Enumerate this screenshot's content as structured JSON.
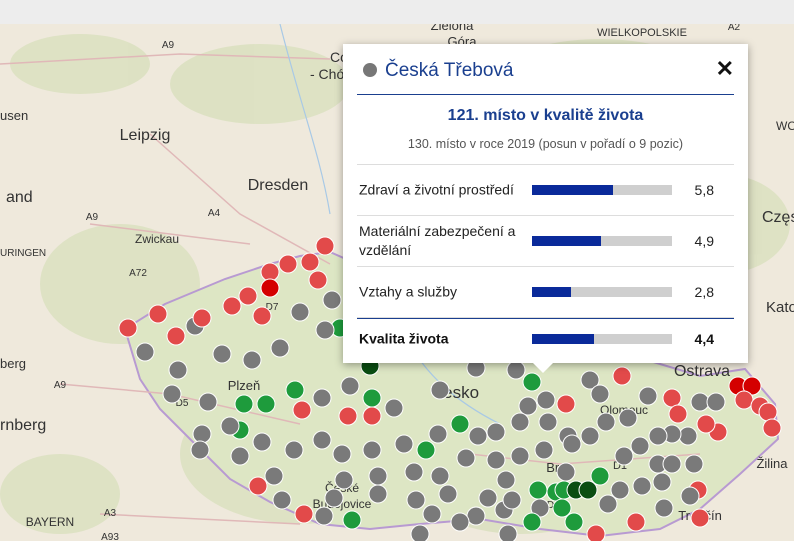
{
  "map": {
    "labels": [
      {
        "text": "Zielona",
        "id": "zielona"
      },
      {
        "text": "Góra",
        "id": "gora"
      },
      {
        "text": "WIELKOPOLSKIE",
        "id": "wielkopolskie"
      },
      {
        "text": "A2",
        "id": "a2-top"
      },
      {
        "text": "Cottb",
        "id": "cottbus"
      },
      {
        "text": "- Chóś",
        "id": "chos"
      },
      {
        "text": "A9",
        "id": "a9-top"
      },
      {
        "text": "usen",
        "id": "usen"
      },
      {
        "text": "Leipzig",
        "id": "leipzig"
      },
      {
        "text": "Dresden",
        "id": "dresden"
      },
      {
        "text": "and",
        "id": "and"
      },
      {
        "text": "A9",
        "id": "a9-mid"
      },
      {
        "text": "A4",
        "id": "a4"
      },
      {
        "text": "Zwickau",
        "id": "zwickau"
      },
      {
        "text": "URINGEN",
        "id": "uringen"
      },
      {
        "text": "A72",
        "id": "a72"
      },
      {
        "text": "berg",
        "id": "berg"
      },
      {
        "text": "A9",
        "id": "a9-low"
      },
      {
        "text": "Plzeň",
        "id": "plzen"
      },
      {
        "text": "D5",
        "id": "d5"
      },
      {
        "text": "Česko",
        "id": "cesko"
      },
      {
        "text": "rnberg",
        "id": "nurnberg"
      },
      {
        "text": "Olomouc",
        "id": "olomouc"
      },
      {
        "text": "Ostrava",
        "id": "ostrava"
      },
      {
        "text": "Brno",
        "id": "brno"
      },
      {
        "text": "D1",
        "id": "d1"
      },
      {
        "text": "D52",
        "id": "d52"
      },
      {
        "text": "České",
        "id": "ceske"
      },
      {
        "text": "Budějovice",
        "id": "budejovice"
      },
      {
        "text": "Žilina",
        "id": "zilina"
      },
      {
        "text": "Trenčín",
        "id": "trencin"
      },
      {
        "text": "BAYERN",
        "id": "bayern"
      },
      {
        "text": "A3",
        "id": "a3"
      },
      {
        "text": "A93",
        "id": "a93"
      },
      {
        "text": "Częst",
        "id": "czest"
      },
      {
        "text": "Kato",
        "id": "kato"
      },
      {
        "text": "WO",
        "id": "wo"
      },
      {
        "text": "D7",
        "id": "d7"
      }
    ],
    "colors": {
      "red": "#e24a4a",
      "darkred": "#d40000",
      "grey": "#7a7a7a",
      "green": "#1e9b3c",
      "darkgreen": "#0a4d12"
    }
  },
  "popup": {
    "title": "Česká Třebová",
    "close_label": "✕",
    "rank_title": "121. místo v kvalitě života",
    "rank_sub": "130. místo v roce 2019 (posun v pořadí o 9 pozic)",
    "rows": [
      {
        "label": "Zdraví a životní prostředí",
        "value": "5,8",
        "fraction": 0.58
      },
      {
        "label": "Materiální zabezpečení a vzdělání",
        "value": "4,9",
        "fraction": 0.49
      },
      {
        "label": "Vztahy a služby",
        "value": "2,8",
        "fraction": 0.28
      },
      {
        "label": "Kvalita života",
        "value": "4,4",
        "fraction": 0.44
      }
    ]
  }
}
